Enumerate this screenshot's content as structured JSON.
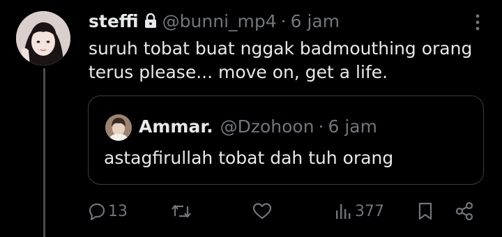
{
  "tweet": {
    "display_name": "steffi",
    "handle": "@bunni_mp4",
    "separator": "·",
    "time": "6 jam",
    "text_lines": [
      "suruh tobat buat nggak badmouthing orang",
      "terus please... move on, get a life."
    ],
    "icons": {
      "lock": "lock-icon",
      "more": "more-icon"
    }
  },
  "quote": {
    "display_name": "Ammar.",
    "handle": "@Dzohoon",
    "separator": "·",
    "time": "6 jam",
    "text": "astagfirullah tobat dah tuh orang"
  },
  "actions": {
    "reply_count": "13",
    "views_count": "377"
  },
  "colors": {
    "background": "#000000",
    "primary_text": "#e7e9ea",
    "secondary_text": "#71767b",
    "border": "#3a3d41",
    "thread_line": "#4a4d50"
  }
}
